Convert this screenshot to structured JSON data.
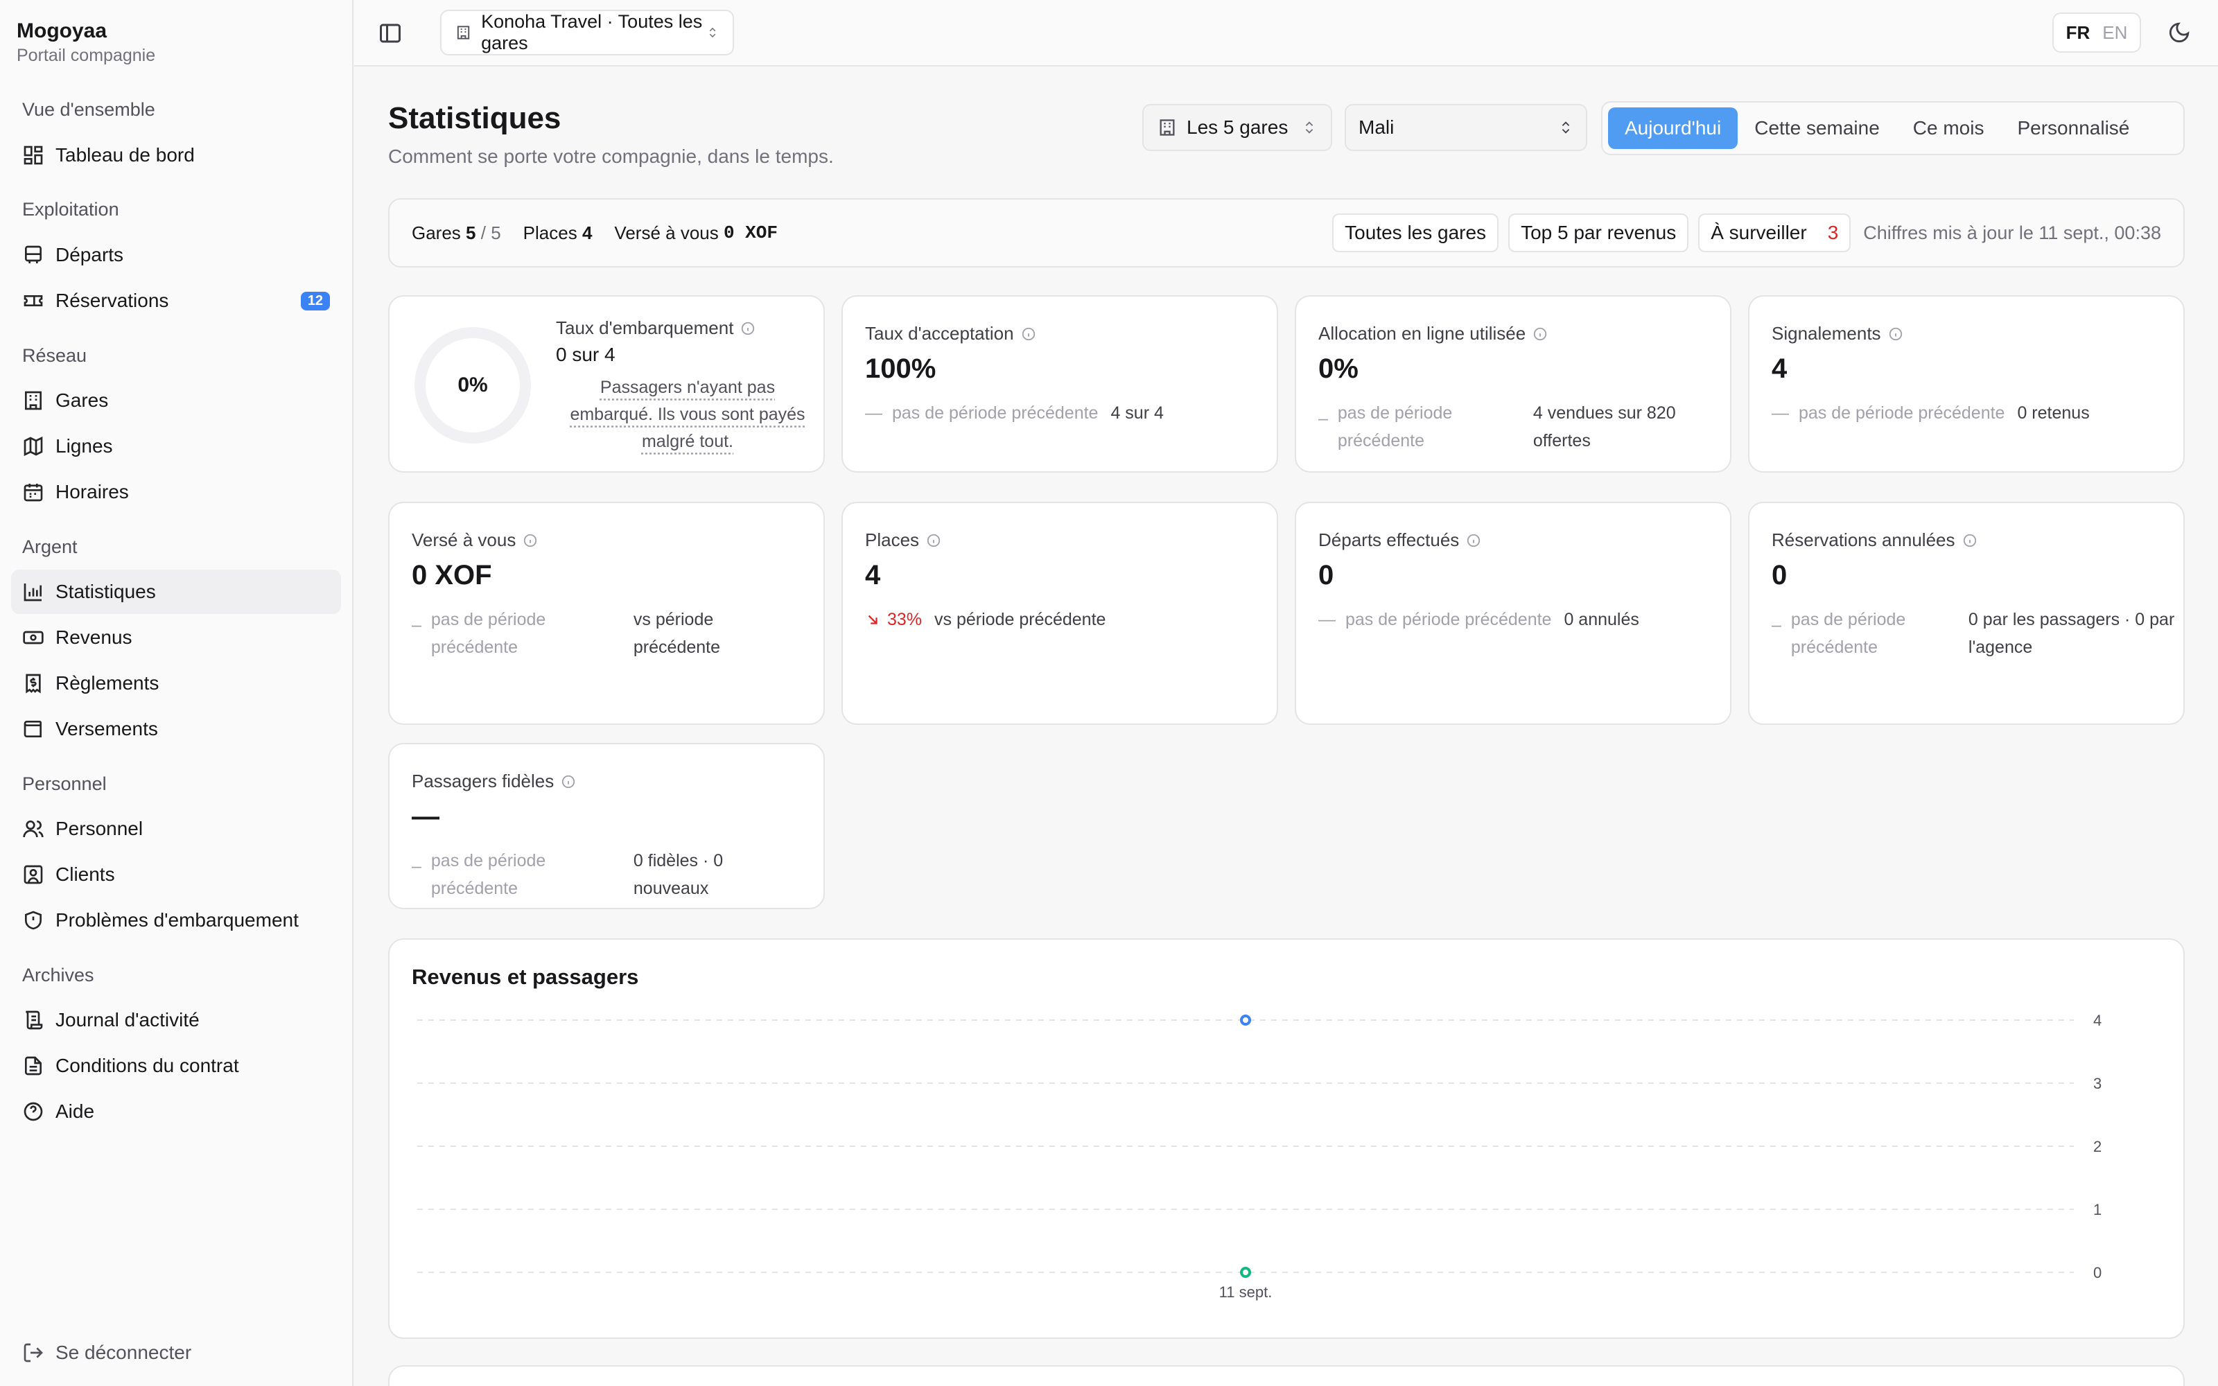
{
  "brand": {
    "name": "Mogoyaa",
    "subtitle": "Portail compagnie"
  },
  "sidebar": {
    "sections": [
      "Vue d'ensemble",
      "Exploitation",
      "Réseau",
      "Argent",
      "Personnel",
      "Archives"
    ],
    "items": [
      {
        "label": "Tableau de bord",
        "icon": "dashboard-icon"
      },
      {
        "label": "Départs",
        "icon": "bus-icon"
      },
      {
        "label": "Réservations",
        "icon": "ticket-icon",
        "badge": "12"
      },
      {
        "label": "Gares",
        "icon": "building-icon"
      },
      {
        "label": "Lignes",
        "icon": "map-icon"
      },
      {
        "label": "Horaires",
        "icon": "calendar-icon"
      },
      {
        "label": "Statistiques",
        "icon": "bar-chart-icon",
        "active": true
      },
      {
        "label": "Revenus",
        "icon": "banknote-icon"
      },
      {
        "label": "Règlements",
        "icon": "receipt-icon"
      },
      {
        "label": "Versements",
        "icon": "wallet-icon"
      },
      {
        "label": "Personnel",
        "icon": "users-icon"
      },
      {
        "label": "Clients",
        "icon": "contact-icon"
      },
      {
        "label": "Problèmes d'embarquement",
        "icon": "shield-icon"
      },
      {
        "label": "Journal d'activité",
        "icon": "scroll-icon"
      },
      {
        "label": "Conditions du contrat",
        "icon": "file-text-icon"
      },
      {
        "label": "Aide",
        "icon": "help-circle-icon"
      }
    ],
    "logout": "Se déconnecter"
  },
  "topbar": {
    "org": "Konoha Travel · Toutes les gares",
    "lang": {
      "fr": "FR",
      "en": "EN"
    }
  },
  "header": {
    "title": "Statistiques",
    "subtitle": "Comment se porte votre compagnie, dans le temps.",
    "station_filter": "Les 5 gares",
    "country_filter": "Mali",
    "periods": [
      "Aujourd'hui",
      "Cette semaine",
      "Ce mois",
      "Personnalisé"
    ]
  },
  "summary": {
    "gares_label": "Gares",
    "gares_value": "5",
    "gares_total": "/ 5",
    "places_label": "Places",
    "places_value": "4",
    "verse_label": "Versé à vous",
    "verse_value": "0 XOF",
    "btn_all": "Toutes les gares",
    "btn_top": "Top 5 par revenus",
    "btn_watch": "À surveiller",
    "watch_count": "3",
    "updated": "Chiffres mis à jour le 11 sept., 00:38"
  },
  "cards": {
    "embarquement": {
      "label": "Taux d'embarquement",
      "ring": "0%",
      "value": "0 sur 4",
      "note": "Passagers n'ayant pas embarqué. Ils vous sont payés malgré tout."
    },
    "acceptation": {
      "label": "Taux d'acceptation",
      "value": "100%",
      "dash": "—",
      "delta": "pas de période précédente",
      "extra": "4 sur 4"
    },
    "allocation": {
      "label": "Allocation en ligne utilisée",
      "value": "0%",
      "dash": "–",
      "delta": "pas de période précédente",
      "extra": "4 vendues sur 820 offertes"
    },
    "signalements": {
      "label": "Signalements",
      "value": "4",
      "dash": "—",
      "delta": "pas de période précédente",
      "extra": "0 retenus"
    },
    "verse": {
      "label": "Versé à vous",
      "value": "0 XOF",
      "dash": "–",
      "delta": "pas de période précédente",
      "extra": "vs période précédente"
    },
    "places": {
      "label": "Places",
      "value": "4",
      "delta": "33%",
      "extra": "vs période précédente"
    },
    "departs": {
      "label": "Départs effectués",
      "value": "0",
      "dash": "—",
      "delta": "pas de période précédente",
      "extra": "0 annulés"
    },
    "annulees": {
      "label": "Réservations annulées",
      "value": "0",
      "dash": "–",
      "delta": "pas de période précédente",
      "extra": "0 par les passagers · 0 par l'agence"
    },
    "fideles": {
      "label": "Passagers fidèles",
      "value": "—",
      "dash": "–",
      "delta": "pas de période précédente",
      "extra": "0 fidèles · 0 nouveaux"
    }
  },
  "chart_data": {
    "type": "line",
    "title": "Revenus et passagers",
    "categories": [
      "11 sept."
    ],
    "series": [
      {
        "values": [
          4
        ],
        "color": "#3b82f6"
      },
      {
        "values": [
          0
        ],
        "color": "#10b981"
      }
    ],
    "ylim": [
      0,
      4
    ],
    "yticks": [
      "0",
      "1",
      "2",
      "3",
      "4"
    ],
    "grid": true
  }
}
